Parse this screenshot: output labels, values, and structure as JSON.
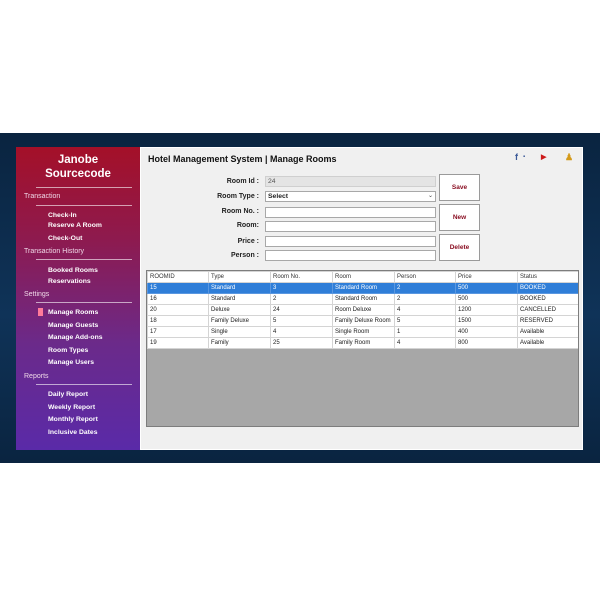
{
  "sidebar": {
    "brand_line1": "Janobe",
    "brand_line2": "Sourcecode",
    "sections": [
      {
        "label": "Transaction",
        "items": [
          "Check-In",
          "Reserve A Room",
          "Check-Out"
        ]
      },
      {
        "label": "Transaction History",
        "items": [
          "Booked Rooms",
          "Reservations"
        ]
      },
      {
        "label": "Settings",
        "items": [
          "Manage Rooms",
          "Manage Guests",
          "Manage Add-ons",
          "Room Types",
          "Manage Users"
        ]
      },
      {
        "label": "Reports",
        "items": [
          "Daily Report",
          "Weekly Report",
          "Monthly Report",
          "Inclusive Dates"
        ]
      }
    ],
    "active_item": "Manage Rooms"
  },
  "header": {
    "title": "Hotel Management System | Manage Rooms",
    "icons": [
      "facebook-icon",
      "youtube-icon",
      "user-icon"
    ]
  },
  "form": {
    "room_id_label": "Room Id :",
    "room_id_value": "24",
    "room_type_label": "Room Type :",
    "room_type_value": "Select",
    "room_no_label": "Room No. :",
    "room_no_value": "",
    "room_label": "Room:",
    "room_value": "",
    "price_label": "Price :",
    "price_value": "",
    "person_label": "Person :",
    "person_value": ""
  },
  "buttons": {
    "save": "Save",
    "new": "New",
    "delete": "Delete"
  },
  "table": {
    "columns": [
      "ROOMID",
      "Type",
      "Room No.",
      "Room",
      "Person",
      "Price",
      "Status"
    ],
    "rows": [
      [
        "15",
        "Standard",
        "3",
        "Standard Room",
        "2",
        "500",
        "BOOKED"
      ],
      [
        "16",
        "Standard",
        "2",
        "Standard Room",
        "2",
        "500",
        "BOOKED"
      ],
      [
        "20",
        "Deluxe",
        "24",
        "Room Deluxe",
        "4",
        "1200",
        "CANCELLED"
      ],
      [
        "18",
        "Family Deluxe",
        "5",
        "Family Deluxe Room",
        "5",
        "1500",
        "RESERVED"
      ],
      [
        "17",
        "Single",
        "4",
        "Single Room",
        "1",
        "400",
        "Available"
      ],
      [
        "19",
        "Family",
        "25",
        "Family Room",
        "4",
        "800",
        "Available"
      ]
    ],
    "selected_row": 0
  },
  "colors": {
    "sidebar_top": "#a41028",
    "sidebar_bottom": "#5a2aa8",
    "selection": "#2f7ed8",
    "button_text": "#8a0e22"
  }
}
